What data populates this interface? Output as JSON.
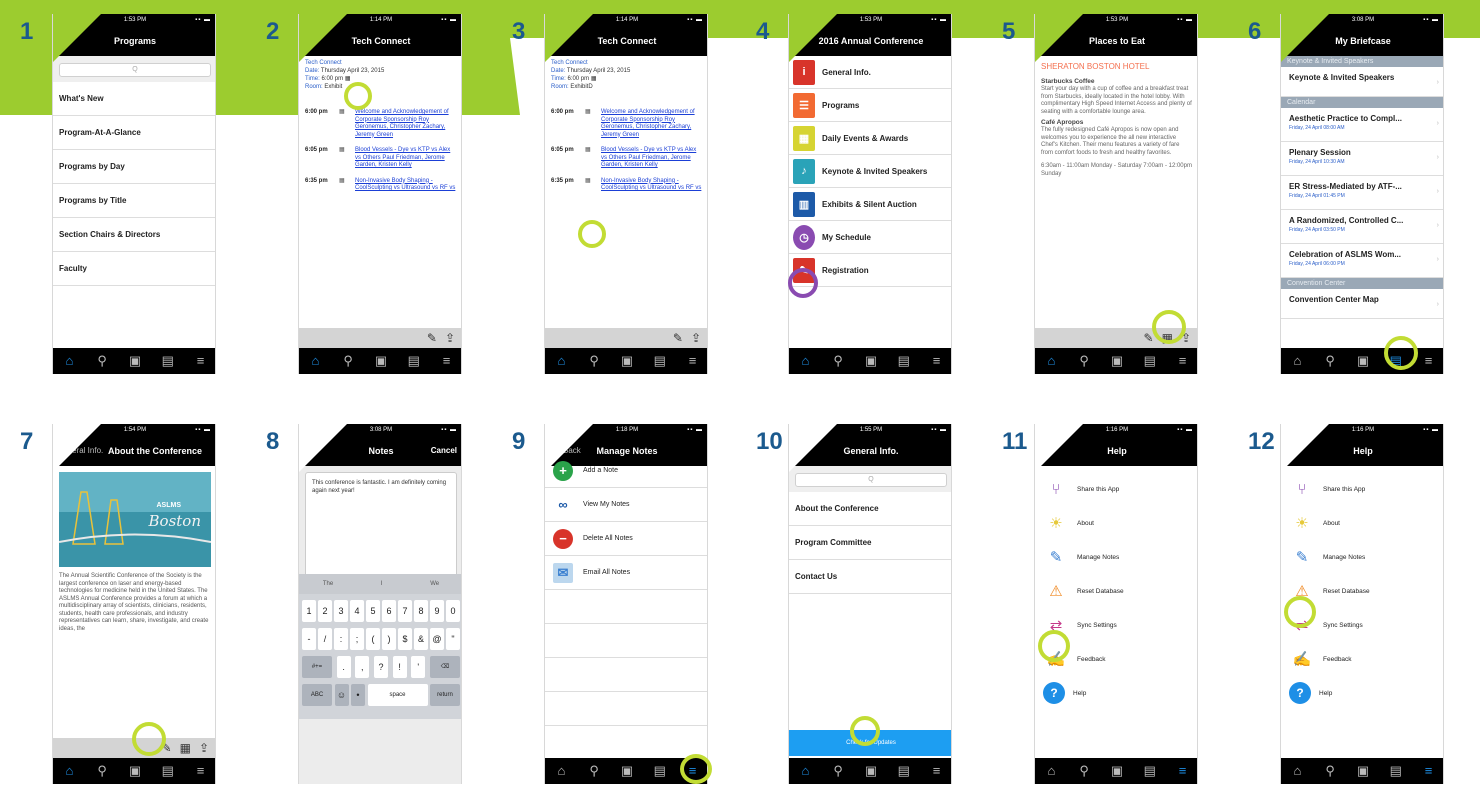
{
  "colors": {
    "accent": "#9ccc2f",
    "highlight": "#c2dc34",
    "number": "#9ccc2f",
    "number_row2": "#1b5a8e",
    "link": "#1b3fd6",
    "brand_orange": "#f46f4e",
    "tab_active": "#1e8fe6"
  },
  "tabbar": {
    "icons": [
      "home-icon",
      "search-icon",
      "meeting-icon",
      "briefcase-icon",
      "menu-icon"
    ]
  },
  "panel1": {
    "number": "1",
    "time": "1:53 PM",
    "title": "Programs",
    "search_placeholder": "Q",
    "items": [
      "What's New",
      "Program-At-A-Glance",
      "Programs by Day",
      "Programs by Title",
      "Section Chairs & Directors",
      "Faculty"
    ]
  },
  "panel2": {
    "number": "2",
    "time": "1:14 PM",
    "title": "Tech Connect",
    "heading": "Tech Connect",
    "date_label": "Date:",
    "date": "Thursday April 23, 2015",
    "time_label": "Time:",
    "time_val": "6:00 pm",
    "room_label": "Room:",
    "room": "Exhibit",
    "sessions": [
      {
        "time": "6:00 pm",
        "text": "Welcome and Acknowledgement of Corporate Sponsorship Roy Geronemus, Christopher Zachary, Jeremy Green"
      },
      {
        "time": "6:05 pm",
        "text": "Blood Vessels - Dye vs KTP vs Alex vs Others Paul Friedman, Jerome Garden, Kristen Kelly"
      },
      {
        "time": "6:35 pm",
        "text": "Non-Invasive Body Shaping - CoolSculpting vs Ultrasound vs RF vs"
      }
    ]
  },
  "panel3": {
    "number": "3",
    "time": "1:14 PM",
    "title": "Tech Connect",
    "heading": "Tech Connect",
    "date_label": "Date:",
    "date": "Thursday April 23, 2015",
    "time_label": "Time:",
    "time_val": "6:00 pm",
    "room_label": "Room:",
    "room": "ExhibitD",
    "sessions": [
      {
        "time": "6:00 pm",
        "text": "Welcome and Acknowledgement of Corporate Sponsorship Roy Geronemus, Christopher Zachary, Jeremy Green"
      },
      {
        "time": "6:05 pm",
        "text": "Blood Vessels - Dye vs KTP vs Alex vs Others Paul Friedman, Jerome Garden, Kristen Kelly"
      },
      {
        "time": "6:35 pm",
        "text": "Non-Invasive Body Shaping - CoolSculpting vs Ultrasound vs RF vs"
      }
    ]
  },
  "panel4": {
    "number": "4",
    "time": "1:53 PM",
    "title": "2016 Annual Conference",
    "items": [
      {
        "label": "General Info.",
        "icon": "info-icon",
        "glyph": "i",
        "color": "#d8342a"
      },
      {
        "label": "Programs",
        "icon": "programs-icon",
        "glyph": "☰",
        "color": "#f26a32"
      },
      {
        "label": "Daily Events & Awards",
        "icon": "calendar-icon",
        "glyph": "☷",
        "color": "#d6d432"
      },
      {
        "label": "Keynote & Invited Speakers",
        "icon": "microphone-icon",
        "glyph": "♩",
        "color": "#2aa3b8"
      },
      {
        "label": "Exhibits & Silent Auction",
        "icon": "exhibits-icon",
        "glyph": "▦",
        "color": "#1d5aa8"
      },
      {
        "label": "My Schedule",
        "icon": "clock-icon",
        "glyph": "◷",
        "color": "#8a4bb1"
      },
      {
        "label": "Registration",
        "icon": "registration-icon",
        "glyph": "✎",
        "color": "#d8342a"
      }
    ]
  },
  "panel5": {
    "number": "5",
    "time": "1:53 PM",
    "title": "Places to Eat",
    "hotel": "SHERATON BOSTON HOTEL",
    "place1": "Starbucks Coffee",
    "desc1": "Start your day with a cup of coffee and a breakfast treat from Starbucks, ideally located in the hotel lobby. With complimentary High Speed Internet Access and plenty of seating with a comfortable lounge area.",
    "place2": "Café Apropos",
    "desc2": "The fully redesigned Café Apropos is now open and welcomes you to experience the all new interactive Chef's Kitchen. Their menu features a variety of fare from comfort foods to fresh and healthy favorites.",
    "hours": "6:30am - 11:00am Monday - Saturday 7:00am - 12:00pm Sunday"
  },
  "panel6": {
    "number": "6",
    "time": "3:08 PM",
    "title": "My Briefcase",
    "section1": "Keynote & Invited Speakers",
    "item1": "Keynote & Invited Speakers",
    "section2": "Calendar",
    "events": [
      {
        "name": "Aesthetic Practice to Compl...",
        "date": "Friday, 24 April 08:00 AM"
      },
      {
        "name": "Plenary Session",
        "date": "Friday, 24 April 10:30 AM"
      },
      {
        "name": "ER Stress-Mediated by ATF-...",
        "date": "Friday, 24 April 01:45 PM"
      },
      {
        "name": "A Randomized, Controlled C...",
        "date": "Friday, 24 April 03:50 PM"
      },
      {
        "name": "Celebration of ASLMS Wom...",
        "date": "Friday, 24 April 06:00 PM"
      }
    ],
    "section3": "Convention Center",
    "item3": "Convention Center Map"
  },
  "panel7": {
    "number": "7",
    "time": "1:54 PM",
    "back": "General Info.",
    "title": "About the Conference",
    "brand": "Boston",
    "tag": "ASLMS",
    "body": "The Annual Scientific Conference of the Society is the largest conference on laser and energy-based technologies for medicine held in the United States. The ASLMS Annual Conference provides a forum at which a multidisciplinary array of scientists, clinicians, residents, students, health care professionals, and industry representatives can learn, share, investigate, and create ideas, the"
  },
  "panel8": {
    "number": "8",
    "time": "3:08 PM",
    "title": "Notes",
    "cancel": "Cancel",
    "note": "This conference is fantastic. I am definitely coming again next year!",
    "suggestions": [
      "The",
      "I",
      "We"
    ],
    "row1": [
      "1",
      "2",
      "3",
      "4",
      "5",
      "6",
      "7",
      "8",
      "9",
      "0"
    ],
    "row2": [
      "-",
      "/",
      ":",
      ";",
      "(",
      ")",
      "$",
      "&",
      "@",
      "\""
    ],
    "row3": [
      "#+=",
      ".",
      ",",
      "?",
      "!",
      "'",
      "⌫"
    ],
    "row4": [
      "ABC",
      "☺",
      "•",
      "space",
      "return"
    ]
  },
  "panel9": {
    "number": "9",
    "time": "1:18 PM",
    "back": "Back",
    "title": "Manage Notes",
    "items": [
      {
        "label": "Add a Note",
        "icon": "add-icon",
        "glyph": "+",
        "color": "#2aa34a"
      },
      {
        "label": "View My Notes",
        "icon": "glasses-icon",
        "glyph": "∞",
        "color": "#1d5aa8"
      },
      {
        "label": "Delete All Notes",
        "icon": "delete-icon",
        "glyph": "−",
        "color": "#d8342a"
      },
      {
        "label": "Email All Notes",
        "icon": "email-icon",
        "glyph": "✉",
        "color": "#6aa8d8"
      }
    ]
  },
  "panel10": {
    "number": "10",
    "time": "1:55 PM",
    "title": "General Info.",
    "search_placeholder": "Q",
    "items": [
      "About the Conference",
      "Program Committee",
      "Contact Us"
    ],
    "button": "Check for Updates"
  },
  "panel11": {
    "number": "11",
    "time": "1:16 PM",
    "title": "Help",
    "items": [
      {
        "label": "Share this App",
        "icon": "share-icon",
        "glyph": "⑂",
        "color": "#8a4bb1"
      },
      {
        "label": "About",
        "icon": "lightbulb-icon",
        "glyph": "☀",
        "color": "#e6c93a"
      },
      {
        "label": "Manage Notes",
        "icon": "notes-icon",
        "glyph": "✎",
        "color": "#3a7fd0"
      },
      {
        "label": "Reset Database",
        "icon": "warning-icon",
        "glyph": "⚠",
        "color": "#f08a24"
      },
      {
        "label": "Sync Settings",
        "icon": "sync-icon",
        "glyph": "⇄",
        "color": "#c53a8a"
      },
      {
        "label": "Feedback",
        "icon": "feedback-icon",
        "glyph": "✍",
        "color": "#3aa83a"
      },
      {
        "label": "Help",
        "icon": "help-icon",
        "glyph": "?",
        "color": "#1e8fe6"
      }
    ]
  },
  "panel12": {
    "number": "12",
    "time": "1:16 PM",
    "title": "Help",
    "items": [
      {
        "label": "Share this App",
        "icon": "share-icon",
        "glyph": "⑂",
        "color": "#8a4bb1"
      },
      {
        "label": "About",
        "icon": "lightbulb-icon",
        "glyph": "☀",
        "color": "#e6c93a"
      },
      {
        "label": "Manage Notes",
        "icon": "notes-icon",
        "glyph": "✎",
        "color": "#3a7fd0"
      },
      {
        "label": "Reset Database",
        "icon": "warning-icon",
        "glyph": "⚠",
        "color": "#f08a24"
      },
      {
        "label": "Sync Settings",
        "icon": "sync-icon",
        "glyph": "⇄",
        "color": "#c53a8a"
      },
      {
        "label": "Feedback",
        "icon": "feedback-icon",
        "glyph": "✍",
        "color": "#3aa83a"
      },
      {
        "label": "Help",
        "icon": "help-icon",
        "glyph": "?",
        "color": "#1e8fe6"
      }
    ]
  }
}
